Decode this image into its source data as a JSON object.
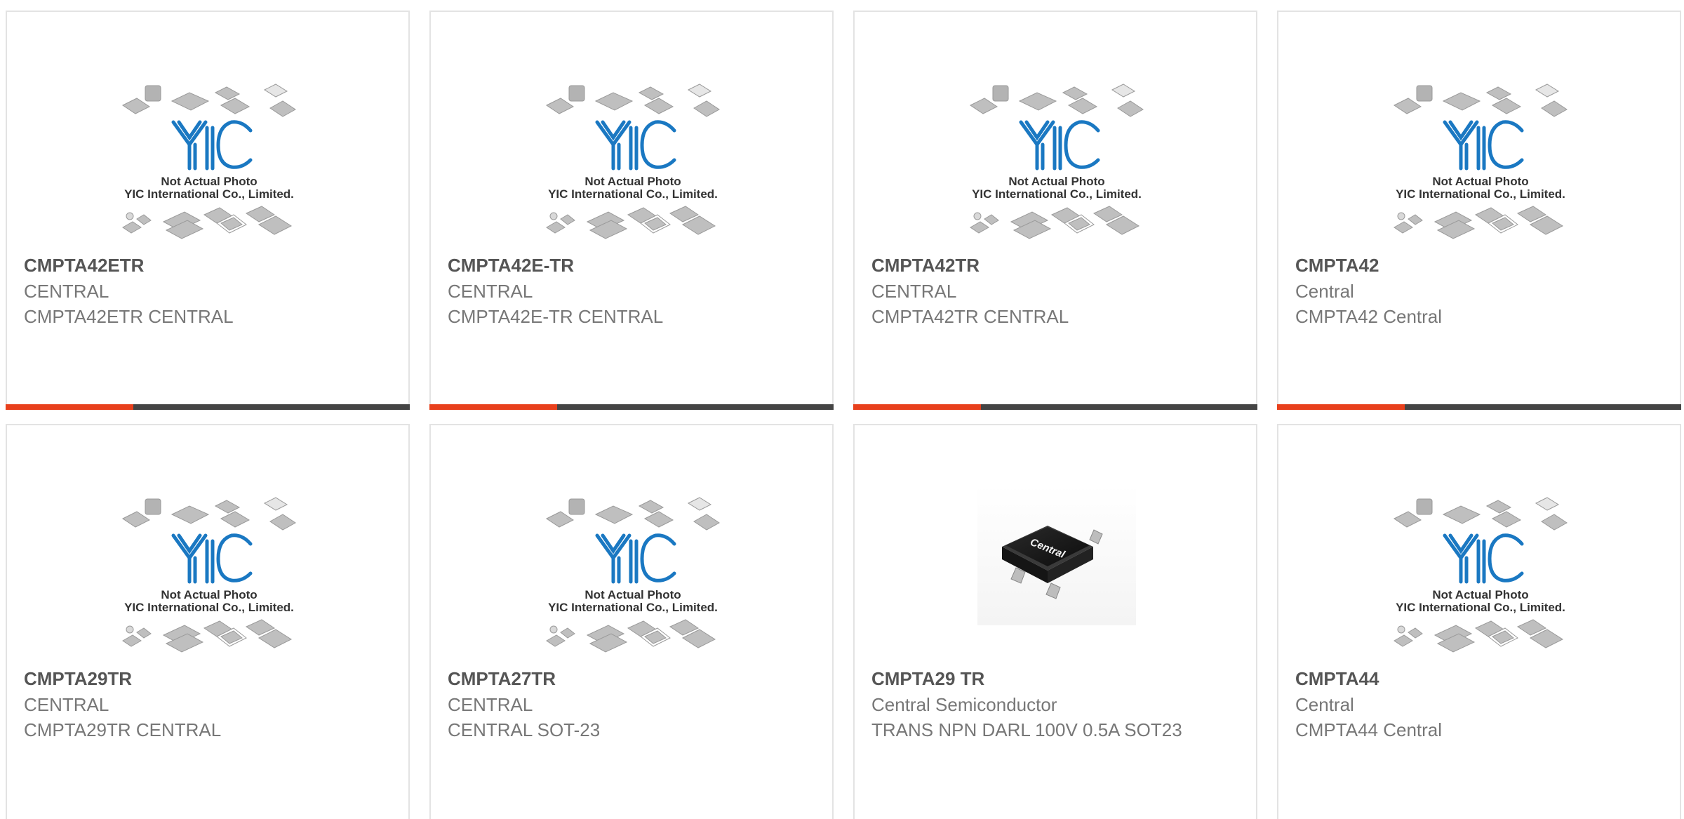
{
  "placeholder": {
    "logo_text": "YIC",
    "line1": "Not Actual Photo",
    "line2": "YIC International Co., Limited."
  },
  "products": [
    {
      "part": "CMPTA42ETR",
      "manufacturer": "CENTRAL",
      "description": "CMPTA42ETR CENTRAL",
      "image": "placeholder"
    },
    {
      "part": "CMPTA42E-TR",
      "manufacturer": "CENTRAL",
      "description": "CMPTA42E-TR CENTRAL",
      "image": "placeholder"
    },
    {
      "part": "CMPTA42TR",
      "manufacturer": "CENTRAL",
      "description": "CMPTA42TR CENTRAL",
      "image": "placeholder"
    },
    {
      "part": "CMPTA42",
      "manufacturer": "Central",
      "description": "CMPTA42 Central",
      "image": "placeholder"
    },
    {
      "part": "CMPTA29TR",
      "manufacturer": "CENTRAL",
      "description": "CMPTA29TR CENTRAL",
      "image": "placeholder"
    },
    {
      "part": "CMPTA27TR",
      "manufacturer": "CENTRAL",
      "description": "CENTRAL SOT-23",
      "image": "placeholder"
    },
    {
      "part": "CMPTA29 TR",
      "manufacturer": "Central Semiconductor",
      "description": "TRANS NPN DARL 100V 0.5A SOT23",
      "image": "chip-photo",
      "chip_marking": "Central"
    },
    {
      "part": "CMPTA44",
      "manufacturer": "Central",
      "description": "CMPTA44 Central",
      "image": "placeholder"
    }
  ],
  "colors": {
    "accent": "#e8401c",
    "bar": "#444444",
    "logo_blue": "#1a78c2",
    "part_text": "#555555",
    "body_text": "#777777"
  }
}
